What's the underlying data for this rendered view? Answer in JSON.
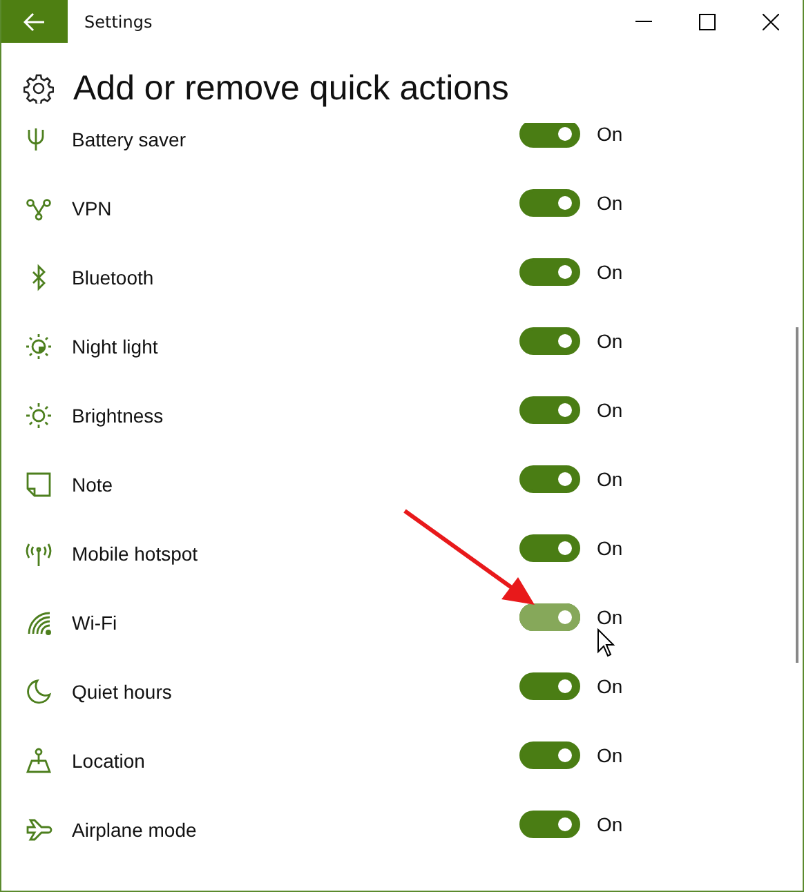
{
  "window": {
    "title": "Settings"
  },
  "page": {
    "title": "Add or remove quick actions"
  },
  "actions": [
    {
      "label": "Battery saver",
      "on": true,
      "hovered": false,
      "state_text": "On"
    },
    {
      "label": "VPN",
      "on": true,
      "hovered": false,
      "state_text": "On"
    },
    {
      "label": "Bluetooth",
      "on": true,
      "hovered": false,
      "state_text": "On"
    },
    {
      "label": "Night light",
      "on": true,
      "hovered": false,
      "state_text": "On"
    },
    {
      "label": "Brightness",
      "on": true,
      "hovered": false,
      "state_text": "On"
    },
    {
      "label": "Note",
      "on": true,
      "hovered": false,
      "state_text": "On"
    },
    {
      "label": "Mobile hotspot",
      "on": true,
      "hovered": false,
      "state_text": "On"
    },
    {
      "label": "Wi-Fi",
      "on": true,
      "hovered": true,
      "state_text": "On"
    },
    {
      "label": "Quiet hours",
      "on": true,
      "hovered": false,
      "state_text": "On"
    },
    {
      "label": "Location",
      "on": true,
      "hovered": false,
      "state_text": "On"
    },
    {
      "label": "Airplane mode",
      "on": true,
      "hovered": false,
      "state_text": "On"
    }
  ]
}
